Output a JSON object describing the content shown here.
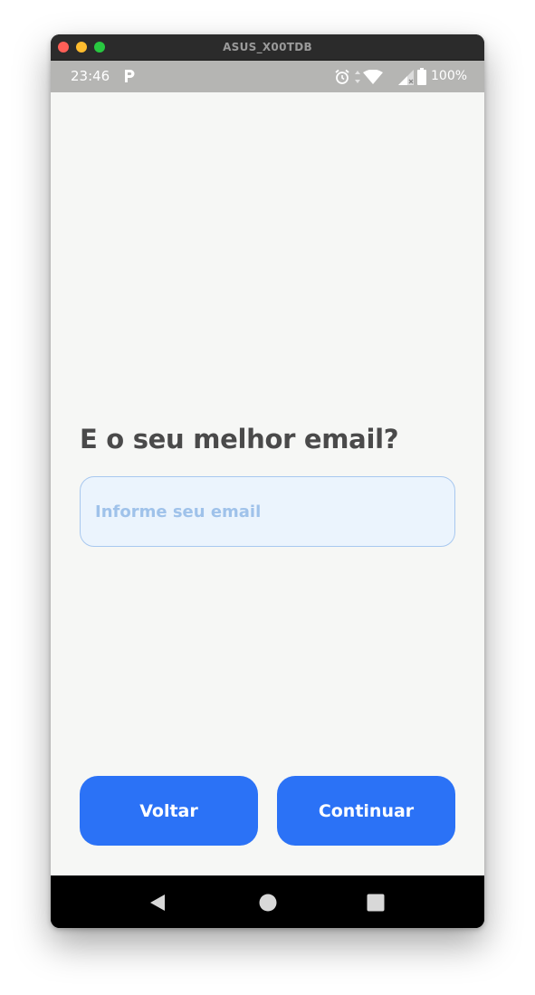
{
  "window": {
    "title": "ASUS_X00TDB"
  },
  "status_bar": {
    "time": "23:46",
    "battery_level": "100%",
    "icons": [
      "p-app-icon",
      "alarm-icon",
      "data-arrows-icon",
      "wifi-icon",
      "signal-icon",
      "battery-icon"
    ]
  },
  "screen": {
    "question": "E o seu melhor email?",
    "email_field": {
      "value": "",
      "placeholder": "Informe seu email"
    },
    "buttons": {
      "back_label": "Voltar",
      "continue_label": "Continuar"
    }
  },
  "nav_bar": {
    "icons": [
      "back-triangle-icon",
      "home-circle-icon",
      "recents-square-icon"
    ]
  },
  "colors": {
    "accent": "#2b72f6",
    "input_background": "#ebf4fd",
    "input_border": "#a8c8ef",
    "placeholder": "#9fc2ea",
    "screen_background": "#f6f7f5",
    "status_bar": "#b5b5b3",
    "question_text": "#4a4a4a"
  }
}
